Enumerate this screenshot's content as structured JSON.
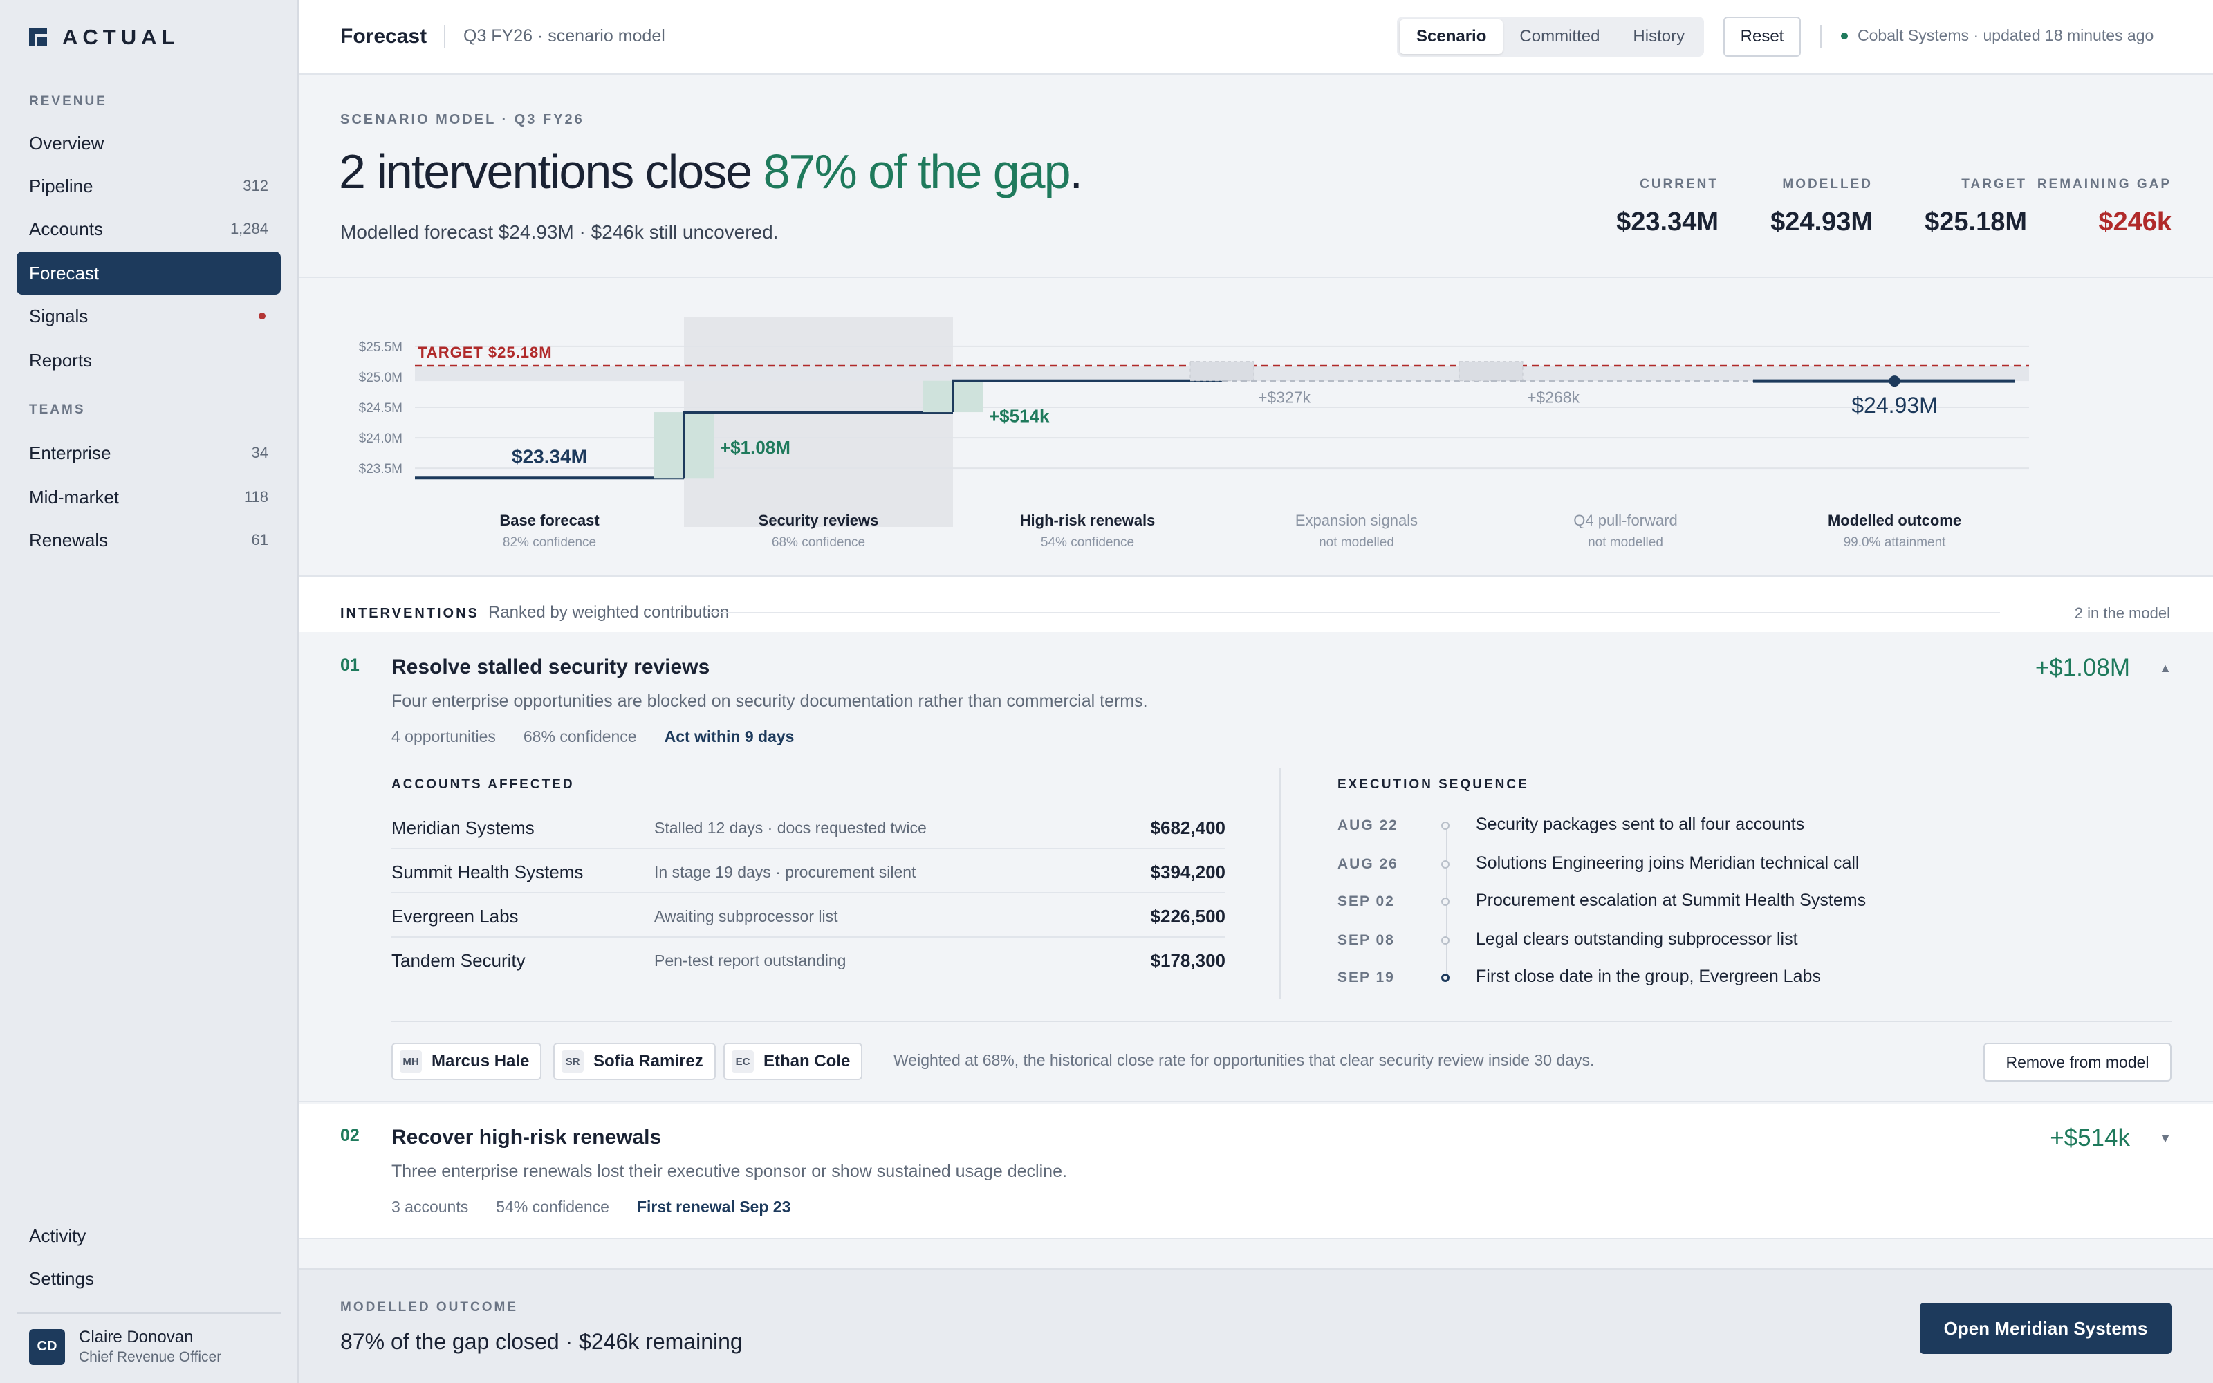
{
  "brand": {
    "name": "ACTUAL",
    "logo_icon": "actual-logo-icon"
  },
  "sidebar": {
    "section_revenue": "REVENUE",
    "section_teams": "TEAMS",
    "revenue_items": [
      {
        "label": "Overview",
        "count": ""
      },
      {
        "label": "Pipeline",
        "count": "312"
      },
      {
        "label": "Accounts",
        "count": "1,284"
      },
      {
        "label": "Forecast",
        "count": "",
        "active": true
      },
      {
        "label": "Signals",
        "count": "",
        "alert_dot_color": "#b33636"
      },
      {
        "label": "Reports",
        "count": ""
      }
    ],
    "team_items": [
      {
        "label": "Enterprise",
        "count": "34"
      },
      {
        "label": "Mid-market",
        "count": "118"
      },
      {
        "label": "Renewals",
        "count": "61"
      }
    ],
    "bottom_items": [
      {
        "label": "Activity"
      },
      {
        "label": "Settings"
      }
    ],
    "user": {
      "initials": "CD",
      "name": "Claire Donovan",
      "role": "Chief Revenue Officer"
    }
  },
  "topbar": {
    "title": "Forecast",
    "subtitle": "Q3 FY26 · scenario model",
    "tabs": [
      {
        "label": "Scenario",
        "active": true
      },
      {
        "label": "Committed"
      },
      {
        "label": "History"
      }
    ],
    "reset_label": "Reset",
    "status_text": "Cobalt Systems · updated 18 minutes ago",
    "status_color": "#1f7a5c"
  },
  "hero": {
    "eyebrow": "SCENARIO MODEL · Q3 FY26",
    "headline_prefix": "2 interventions close ",
    "headline_highlight": "87% of the gap",
    "headline_suffix": ".",
    "subtitle": "Modelled forecast $24.93M · $246k still uncovered.",
    "kpis": [
      {
        "label": "CURRENT",
        "value": "$23.34M"
      },
      {
        "label": "MODELLED",
        "value": "$24.93M"
      },
      {
        "label": "TARGET",
        "value": "$25.18M"
      },
      {
        "label": "REMAINING GAP",
        "value": "$246k",
        "negative": true
      }
    ]
  },
  "colors": {
    "accent_green": "#1f7a5c",
    "navy": "#1d3a5c",
    "target_red": "#b02a2a"
  },
  "chart_data": {
    "type": "waterfall",
    "y_ticks": [
      "$23.5M",
      "$24.0M",
      "$24.5M",
      "$25.0M",
      "$25.5M"
    ],
    "ylim": [
      23.4,
      25.6
    ],
    "target": {
      "value": 25.18,
      "label": "TARGET $25.18M"
    },
    "steps": [
      {
        "label": "Base forecast",
        "sub": "82% confidence",
        "kind": "base",
        "value": 23.34,
        "value_label": "$23.34M"
      },
      {
        "label": "Security reviews",
        "sub": "68% confidence",
        "kind": "delta",
        "value": 1.08,
        "value_label": "+$1.08M",
        "highlighted": true
      },
      {
        "label": "High-risk renewals",
        "sub": "54% confidence",
        "kind": "delta",
        "value": 0.514,
        "value_label": "+$514k"
      },
      {
        "label": "Expansion signals",
        "sub": "not modelled",
        "kind": "ghost",
        "value": 0.327,
        "value_label": "+$327k"
      },
      {
        "label": "Q4 pull-forward",
        "sub": "not modelled",
        "kind": "ghost",
        "value": 0.268,
        "value_label": "+$268k"
      },
      {
        "label": "Modelled outcome",
        "sub": "99.0% attainment",
        "kind": "total",
        "value": 24.93,
        "value_label": "$24.93M"
      }
    ]
  },
  "interventions": {
    "title": "INTERVENTIONS",
    "subtitle": "Ranked by weighted contribution",
    "count_text": "2 in the model",
    "items": [
      {
        "num": "01",
        "title": "Resolve stalled security reviews",
        "description": "Four enterprise opportunities are blocked on security documentation rather than commercial terms.",
        "meta": [
          "4 opportunities",
          "68% confidence"
        ],
        "meta_emphasis": "Act within 9 days",
        "amount": "+$1.08M",
        "chevron": "▲",
        "accounts_heading": "ACCOUNTS AFFECTED",
        "accounts": [
          {
            "name": "Meridian Systems",
            "note": "Stalled 12 days · docs requested twice",
            "value": "$682,400"
          },
          {
            "name": "Summit Health Systems",
            "note": "In stage 19 days · procurement silent",
            "value": "$394,200"
          },
          {
            "name": "Evergreen Labs",
            "note": "Awaiting subprocessor list",
            "value": "$226,500"
          },
          {
            "name": "Tandem Security",
            "note": "Pen-test report outstanding",
            "value": "$178,300"
          }
        ],
        "sequence_heading": "EXECUTION SEQUENCE",
        "sequence": [
          {
            "date": "AUG 22",
            "text": "Security packages sent to all four accounts"
          },
          {
            "date": "AUG 26",
            "text": "Solutions Engineering joins Meridian technical call"
          },
          {
            "date": "SEP 02",
            "text": "Procurement escalation at Summit Health Systems"
          },
          {
            "date": "SEP 08",
            "text": "Legal clears outstanding subprocessor list"
          },
          {
            "date": "SEP 19",
            "text": "First close date in the group, Evergreen Labs"
          }
        ],
        "owners": [
          {
            "initials": "MH",
            "name": "Marcus Hale"
          },
          {
            "initials": "SR",
            "name": "Sofia Ramirez"
          },
          {
            "initials": "EC",
            "name": "Ethan Cole"
          }
        ],
        "weight_note": "Weighted at 68%, the historical close rate for opportunities that clear security review inside 30 days.",
        "remove_label": "Remove from model"
      },
      {
        "num": "02",
        "title": "Recover high-risk renewals",
        "description": "Three enterprise renewals lost their executive sponsor or show sustained usage decline.",
        "meta": [
          "3 accounts",
          "54% confidence"
        ],
        "meta_emphasis": "First renewal Sep 23",
        "amount": "+$514k",
        "chevron": "▼"
      }
    ]
  },
  "footer": {
    "eyebrow": "MODELLED OUTCOME",
    "text": "87% of the gap closed · $246k remaining",
    "cta_label": "Open Meridian Systems"
  }
}
